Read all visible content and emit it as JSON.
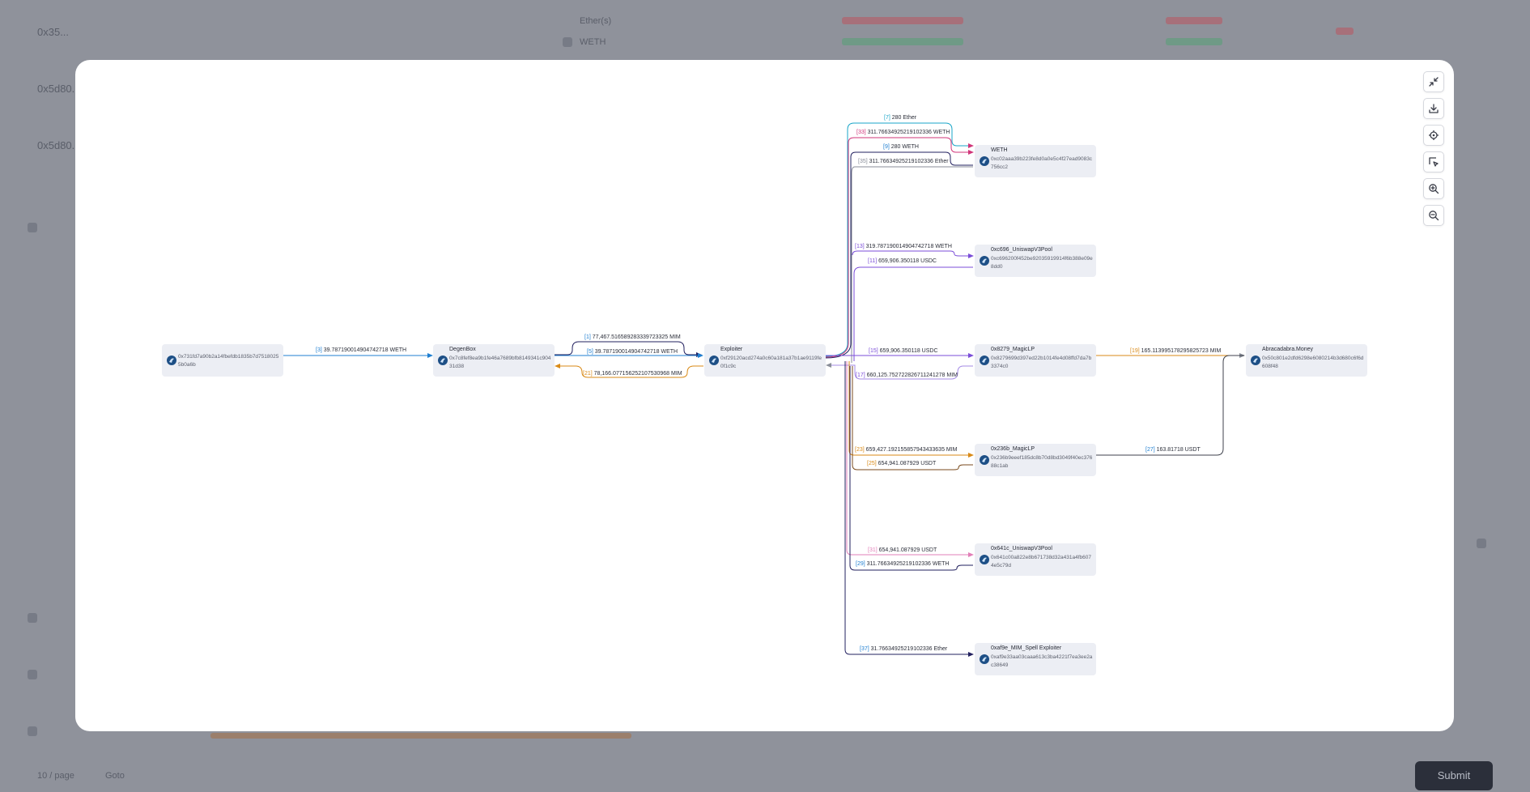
{
  "background": {
    "rows": [
      "0x35...",
      "0x5d80...",
      "0x5d80..."
    ],
    "tokens": [
      "Ether(s)",
      "WETH"
    ],
    "pager": [
      "10 / page",
      "Goto"
    ],
    "button": "Submit"
  },
  "colors": {
    "modal_bg": "#ffffff",
    "node_bg": "#eceef4",
    "accent_blue": "#1f7fd1",
    "cyan": "#1aa6c8",
    "pink": "#d1357a",
    "purple": "#7b4ed8",
    "orange": "#d98a17",
    "navy": "#22205f",
    "brown": "#7a4a1c",
    "gray": "#8a8e99"
  },
  "toolbar": [
    {
      "icon": "minimize-icon"
    },
    {
      "icon": "download-icon"
    },
    {
      "icon": "locate-icon"
    },
    {
      "icon": "select-icon"
    },
    {
      "icon": "zoom-in-icon"
    },
    {
      "icon": "zoom-out-icon"
    }
  ],
  "nodes": {
    "source": {
      "name": "",
      "address": "0x731fd7a90b2a14fbefdb1835b7d75180255b0a6b"
    },
    "degenbox": {
      "name": "DegenBox",
      "address": "0x7c8fef8ea9b1fe46a7689bfb8149341c90431d38"
    },
    "exploiter": {
      "name": "Exploiter",
      "address": "0xf29120acd274a0c60a181a37b1ae9119fe0f1c9c"
    },
    "weth": {
      "name": "WETH",
      "address": "0xc02aaa39b223fe8d0a0e5c4f27ead9083c756cc2"
    },
    "uniswap_c696": {
      "name": "0xc696_UniswapV3Pool",
      "address": "0xc696200f452be92035919914f6b388e09e8dd0"
    },
    "magiclp_8279": {
      "name": "0x8279_MagicLP",
      "address": "0x8279699d397ed22b1014fe4d08ffd7da7b3374c0"
    },
    "abracadabra": {
      "name": "Abracadabra.Money",
      "address": "0x50c801e2dfd6298e6080214b3d680c6f6d608f48"
    },
    "magiclp_236b": {
      "name": "0x236b_MagicLP",
      "address": "0x236b9eeef185dc8b70d8bd3049f40ec37688c1ab"
    },
    "uniswap_641c": {
      "name": "0x641c_UniswapV3Pool",
      "address": "0x641c00a822e8b671738d32a431a4fb6074e5c79d"
    },
    "spell_exploiter": {
      "name": "0xaf9e_MIM_Spell Exploiter",
      "address": "0xaf9e33aa03caaa613c3ba4221f7ea3ee2ac38649"
    }
  },
  "edges": {
    "e3": {
      "index": "[3]",
      "amount": "39.787190014904742718 WETH"
    },
    "e1": {
      "index": "[1]",
      "amount": "77,467.516589283339723325 MIM"
    },
    "e5": {
      "index": "[5]",
      "amount": "39.787190014904742718 WETH"
    },
    "e21": {
      "index": "[21]",
      "amount": "78,166.077156252107530968 MIM"
    },
    "e7": {
      "index": "[7]",
      "amount": "280 Ether"
    },
    "e33": {
      "index": "[33]",
      "amount": "311.76634925219102336 WETH"
    },
    "e9": {
      "index": "[9]",
      "amount": "280 WETH"
    },
    "e35": {
      "index": "[35]",
      "amount": "311.76634925219102336 Ether"
    },
    "e13": {
      "index": "[13]",
      "amount": "319.787190014904742718 WETH"
    },
    "e11": {
      "index": "[11]",
      "amount": "659,906.350118 USDC"
    },
    "e15": {
      "index": "[15]",
      "amount": "659,906.350118 USDC"
    },
    "e17": {
      "index": "[17]",
      "amount": "660,125.752722826711241278 MIM"
    },
    "e19": {
      "index": "[19]",
      "amount": "165.113995178295825723 MIM"
    },
    "e23": {
      "index": "[23]",
      "amount": "659,427.192155857943433635 MIM"
    },
    "e25": {
      "index": "[25]",
      "amount": "654,941.087929 USDT"
    },
    "e27": {
      "index": "[27]",
      "amount": "163.81718 USDT"
    },
    "e31": {
      "index": "[31]",
      "amount": "654,941.087929 USDT"
    },
    "e29": {
      "index": "[29]",
      "amount": "311.76634925219102336 WETH"
    },
    "e37": {
      "index": "[37]",
      "amount": "31.76634925219102336 Ether"
    }
  }
}
